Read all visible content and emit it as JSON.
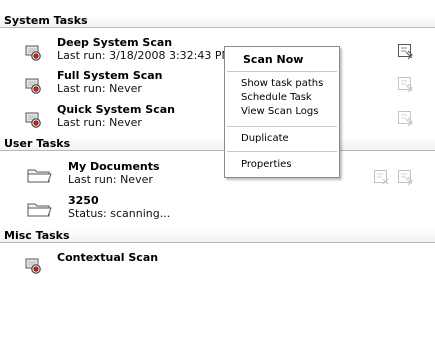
{
  "sections": {
    "system_tasks": "System Tasks",
    "user_tasks": "User Tasks",
    "misc_tasks": "Misc Tasks"
  },
  "system_tasks": [
    {
      "title": "Deep System Scan",
      "subtitle": "Last run: 3/18/2008 3:32:43 PM"
    },
    {
      "title": "Full System Scan",
      "subtitle": "Last run: Never"
    },
    {
      "title": "Quick System Scan",
      "subtitle": "Last run: Never"
    }
  ],
  "user_tasks": [
    {
      "title": "My Documents",
      "subtitle": "Last run: Never"
    },
    {
      "title": "3250",
      "subtitle": "Status:  scanning..."
    }
  ],
  "misc_tasks": [
    {
      "title": "Contextual Scan"
    }
  ],
  "context_menu": {
    "scan_now": "Scan Now",
    "show_task_paths": "Show task paths",
    "schedule_task": "Schedule Task",
    "view_scan_logs": "View Scan Logs",
    "duplicate": "Duplicate",
    "properties": "Properties"
  },
  "icons": {
    "scan_task": "scanner-icon",
    "folder": "folder-icon",
    "run_action": "run-scan-icon",
    "delete_action": "delete-task-icon"
  }
}
